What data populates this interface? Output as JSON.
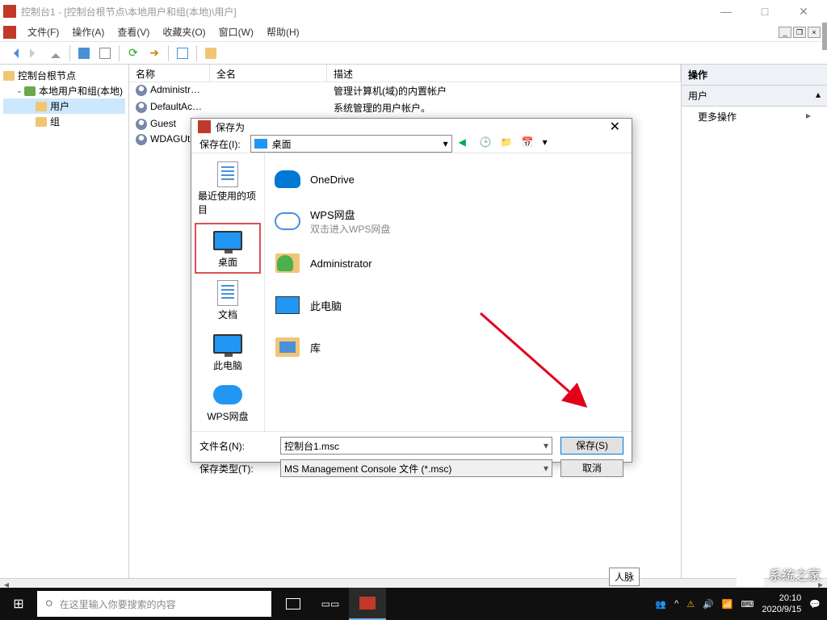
{
  "window": {
    "title": "控制台1 - [控制台根节点\\本地用户和组(本地)\\用户]"
  },
  "menu": {
    "file": "文件(F)",
    "action": "操作(A)",
    "view": "查看(V)",
    "favorites": "收藏夹(O)",
    "window": "窗口(W)",
    "help": "帮助(H)"
  },
  "tree": {
    "root": "控制台根节点",
    "local_users": "本地用户和组(本地)",
    "users": "用户",
    "groups": "组"
  },
  "columns": {
    "name": "名称",
    "fullname": "全名",
    "description": "描述"
  },
  "users": [
    {
      "name": "Administrat...",
      "fullname": "",
      "desc": "管理计算机(域)的内置帐户"
    },
    {
      "name": "DefaultAcc...",
      "fullname": "",
      "desc": "系统管理的用户帐户。"
    },
    {
      "name": "Guest",
      "fullname": "",
      "desc": ""
    },
    {
      "name": "WDAGUtil...",
      "fullname": "",
      "desc": ""
    }
  ],
  "actions": {
    "header": "操作",
    "section": "用户",
    "more": "更多操作"
  },
  "dialog": {
    "title": "保存为",
    "save_in_label": "保存在(I):",
    "save_in_value": "桌面",
    "places": {
      "recent": "最近使用的项目",
      "desktop": "桌面",
      "documents": "文档",
      "this_pc": "此电脑",
      "wps": "WPS网盘"
    },
    "items": [
      {
        "name": "OneDrive",
        "sub": ""
      },
      {
        "name": "WPS网盘",
        "sub": "双击进入WPS网盘"
      },
      {
        "name": "Administrator",
        "sub": ""
      },
      {
        "name": "此电脑",
        "sub": ""
      },
      {
        "name": "库",
        "sub": ""
      }
    ],
    "filename_label": "文件名(N):",
    "filename_value": "控制台1.msc",
    "filetype_label": "保存类型(T):",
    "filetype_value": "MS Management Console 文件 (*.msc)",
    "save_btn": "保存(S)",
    "cancel_btn": "取消"
  },
  "taskbar": {
    "search_placeholder": "在这里输入你要搜索的内容",
    "time": "20:10",
    "date": "2020/9/15",
    "float_label": "人脉"
  },
  "watermark": "系统之家"
}
